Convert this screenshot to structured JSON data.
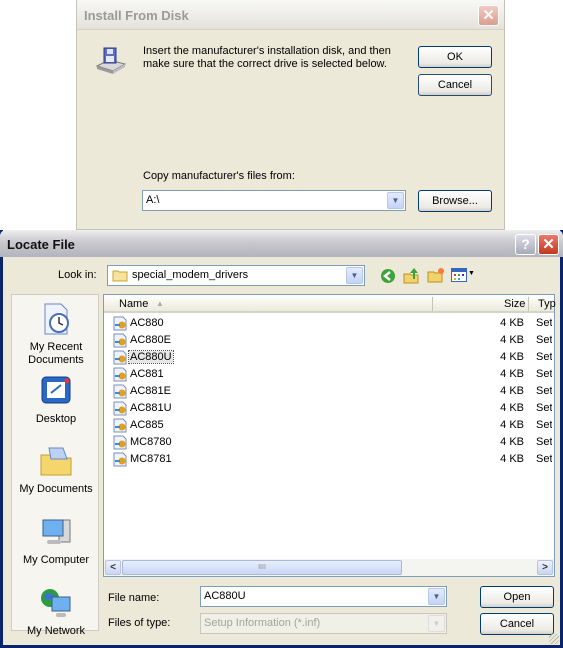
{
  "install_dialog": {
    "title": "Install From Disk",
    "message": "Insert the manufacturer's installation disk, and then make sure that the correct drive is selected below.",
    "ok_label": "OK",
    "cancel_label": "Cancel",
    "copy_from_label": "Copy manufacturer's files from:",
    "copy_from_value": "A:\\",
    "browse_label": "Browse...",
    "close_glyph": "✕"
  },
  "locate_dialog": {
    "title": "Locate File",
    "help_glyph": "?",
    "close_glyph": "✕",
    "look_in_label": "Look in:",
    "look_in_value": "special_modem_drivers",
    "places": [
      {
        "label": "My Recent Documents",
        "icon": "recent-documents-icon"
      },
      {
        "label": "Desktop",
        "icon": "desktop-icon"
      },
      {
        "label": "My Documents",
        "icon": "my-documents-icon"
      },
      {
        "label": "My Computer",
        "icon": "my-computer-icon"
      },
      {
        "label": "My Network",
        "icon": "my-network-icon"
      }
    ],
    "columns": {
      "name": "Name",
      "size": "Size",
      "type": "Typ"
    },
    "files": [
      {
        "name": "AC880",
        "size": "4 KB",
        "type": "Setup Information"
      },
      {
        "name": "AC880E",
        "size": "4 KB",
        "type": "Setup Information"
      },
      {
        "name": "AC880U",
        "size": "4 KB",
        "type": "Setup Information",
        "selected": true
      },
      {
        "name": "AC881",
        "size": "4 KB",
        "type": "Setup Information"
      },
      {
        "name": "AC881E",
        "size": "4 KB",
        "type": "Setup Information"
      },
      {
        "name": "AC881U",
        "size": "4 KB",
        "type": "Setup Information"
      },
      {
        "name": "AC885",
        "size": "4 KB",
        "type": "Setup Information"
      },
      {
        "name": "MC8780",
        "size": "4 KB",
        "type": "Setup Information"
      },
      {
        "name": "MC8781",
        "size": "4 KB",
        "type": "Setup Information"
      }
    ],
    "file_name_label": "File name:",
    "file_name_value": "AC880U",
    "files_of_type_label": "Files of type:",
    "files_of_type_value": "Setup Information (*.inf)",
    "open_label": "Open",
    "cancel_label": "Cancel",
    "scroll_thumb_grip": "IIII"
  }
}
